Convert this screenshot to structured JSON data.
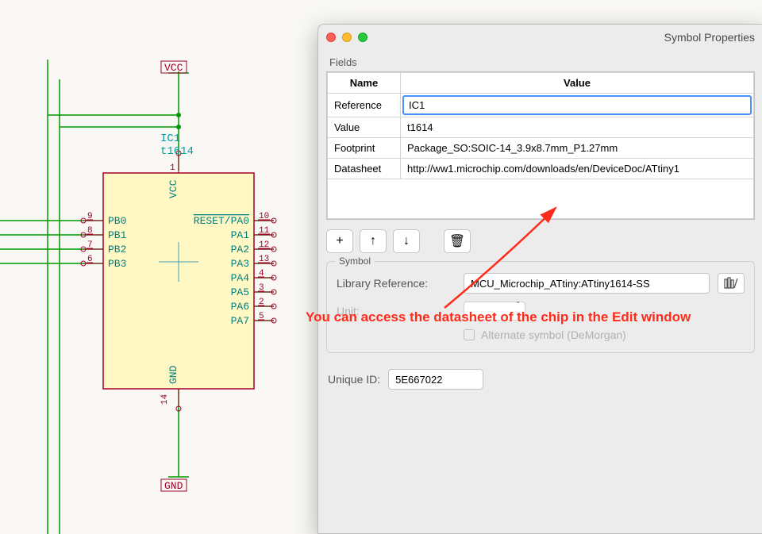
{
  "schematic": {
    "ref": "IC1",
    "value": "t1614",
    "vcc_label": "VCC",
    "gnd_label": "GND",
    "pin_vcc_num": "1",
    "pin_gnd_num": "14",
    "pin_vcc_name": "VCC",
    "pin_gnd_name": "GND",
    "left_pins": [
      {
        "num": "9",
        "name": "PB0"
      },
      {
        "num": "8",
        "name": "PB1"
      },
      {
        "num": "7",
        "name": "PB2"
      },
      {
        "num": "6",
        "name": "PB3"
      }
    ],
    "right_pin_first": {
      "num": "10",
      "name": "RESET/PA0"
    },
    "right_pins": [
      {
        "num": "11",
        "name": "PA1"
      },
      {
        "num": "12",
        "name": "PA2"
      },
      {
        "num": "13",
        "name": "PA3"
      },
      {
        "num": "4",
        "name": "PA4"
      },
      {
        "num": "3",
        "name": "PA5"
      },
      {
        "num": "2",
        "name": "PA6"
      },
      {
        "num": "5",
        "name": "PA7"
      }
    ]
  },
  "dialog": {
    "title": "Symbol Properties",
    "fields_label": "Fields",
    "headers": {
      "name": "Name",
      "value": "Value"
    },
    "rows": {
      "reference": {
        "name": "Reference",
        "value": "IC1"
      },
      "value": {
        "name": "Value",
        "value": "t1614"
      },
      "footprint": {
        "name": "Footprint",
        "value": "Package_SO:SOIC-14_3.9x8.7mm_P1.27mm"
      },
      "datasheet": {
        "name": "Datasheet",
        "value": "http://ww1.microchip.com/downloads/en/DeviceDoc/ATtiny1"
      }
    },
    "buttons": {
      "add": "+",
      "up": "↑",
      "down": "↓",
      "delete": "🗑"
    },
    "symbol": {
      "legend": "Symbol",
      "libref_label": "Library Reference:",
      "libref_value": "MCU_Microchip_ATtiny:ATtiny1614-SS",
      "unit_label": "Unit:",
      "alt_label": "Alternate symbol (DeMorgan)"
    },
    "uid": {
      "label": "Unique ID:",
      "value": "5E667022"
    }
  },
  "annotation": "You can access the datasheet of the chip in the Edit window"
}
